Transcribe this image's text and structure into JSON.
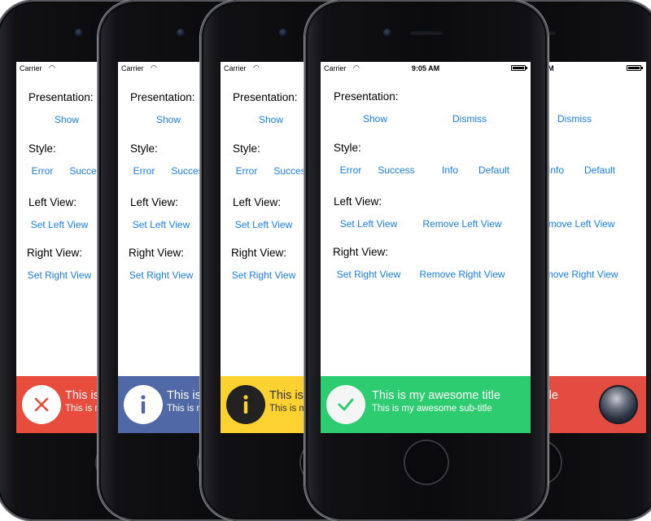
{
  "status": {
    "carrier": "Carrier",
    "time": "9:05 AM"
  },
  "sections": {
    "presentation": "Presentation:",
    "style": "Style:",
    "left_view": "Left View:",
    "right_view": "Right View:"
  },
  "buttons": {
    "show": "Show",
    "dismiss": "Dismiss",
    "error": "Error",
    "success": "Success",
    "info": "Info",
    "default": "Default",
    "set_left_view": "Set Left View",
    "remove_left_view": "Remove Left View",
    "set_right_view": "Set Right View",
    "remove_right_view": "Remove Right View"
  },
  "banner": {
    "title": "This is my awesome title",
    "subtitle": "This is my awesome sub-title"
  },
  "phones": [
    {
      "style": "error",
      "color": "#e74c3c",
      "icon": "close-icon"
    },
    {
      "style": "info",
      "color": "#5068a5",
      "icon": "info-icon"
    },
    {
      "style": "info",
      "color": "#fbd230",
      "icon": "info-icon"
    },
    {
      "style": "success",
      "color": "#2ecc71",
      "icon": "check-icon"
    },
    {
      "style": "default",
      "color": "#e34d41",
      "icon": "avatar"
    }
  ]
}
